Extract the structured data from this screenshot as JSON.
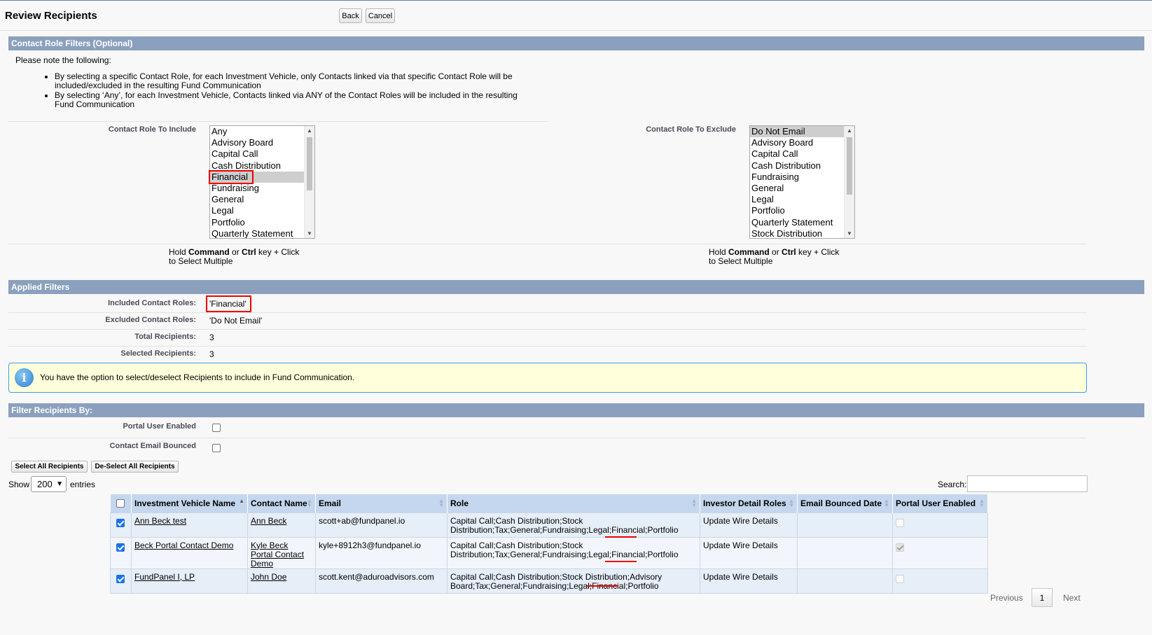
{
  "header": {
    "title": "Review Recipients",
    "back_label": "Back",
    "cancel_label": "Cancel"
  },
  "contact_role_filters": {
    "section_title": "Contact Role Filters (Optional)",
    "note_intro": "Please note the following:",
    "notes": [
      "By selecting a specific Contact Role, for each Investment Vehicle, only Contacts linked via that specific Contact Role will be included/excluded in the resulting Fund Communication",
      "By selecting ‘Any’, for each Investment Vehicle, Contacts linked via ANY of the Contact Roles will be included in the resulting Fund Communication"
    ],
    "include": {
      "label": "Contact Role To Include",
      "options": [
        "Any",
        "Advisory Board",
        "Capital Call",
        "Cash Distribution",
        "Financial",
        "Fundraising",
        "General",
        "Legal",
        "Portfolio",
        "Quarterly Statement"
      ],
      "selected": "Financial"
    },
    "exclude": {
      "label": "Contact Role To Exclude",
      "options": [
        "Do Not Email",
        "Advisory Board",
        "Capital Call",
        "Cash Distribution",
        "Fundraising",
        "General",
        "Legal",
        "Portfolio",
        "Quarterly Statement",
        "Stock Distribution"
      ],
      "selected": "Do Not Email"
    },
    "hint": {
      "hold": "Hold ",
      "command": "Command",
      "or": " or ",
      "ctrl": "Ctrl",
      "rest1": " key + Click",
      "rest2": "to Select Multiple"
    }
  },
  "applied_filters": {
    "section_title": "Applied Filters",
    "rows": [
      {
        "label": "Included Contact Roles:",
        "value": "'Financial'"
      },
      {
        "label": "Excluded Contact Roles:",
        "value": "'Do Not Email'"
      },
      {
        "label": "Total Recipients:",
        "value": "3"
      },
      {
        "label": "Selected Recipients:",
        "value": "3"
      }
    ]
  },
  "info_message": "You have the option to select/deselect Recipients to include in Fund Communication.",
  "filter_recipients": {
    "section_title": "Filter Recipients By:",
    "portal_user_enabled_label": "Portal User Enabled",
    "contact_email_bounced_label": "Contact Email Bounced",
    "portal_user_enabled_checked": false,
    "contact_email_bounced_checked": false
  },
  "actions": {
    "select_all": "Select All Recipients",
    "deselect_all": "De-Select All Recipients"
  },
  "table_controls": {
    "show_label": "Show",
    "entries_value": "200",
    "entries_label": "entries",
    "search_label": "Search:",
    "search_value": ""
  },
  "table": {
    "columns": [
      "Investment Vehicle Name",
      "Contact Name",
      "Email",
      "Role",
      "Investor Detail Roles",
      "Email Bounced Date",
      "Portal User Enabled"
    ],
    "rows": [
      {
        "selected": true,
        "vehicle": "Ann Beck test",
        "contact": "Ann Beck",
        "email": "scott+ab@fundpanel.io",
        "role": "Capital Call;Cash Distribution;Stock Distribution;Tax;General;Fundraising;Legal;Financial;Portfolio",
        "investor_roles": "Update Wire Details",
        "bounced_date": "",
        "portal_enabled": false
      },
      {
        "selected": true,
        "vehicle": "Beck Portal Contact Demo",
        "contact": "Kyle Beck Portal Contact Demo",
        "email": "kyle+8912h3@fundpanel.io",
        "role": "Capital Call;Cash Distribution;Stock Distribution;Tax;General;Fundraising;Legal;Financial;Portfolio",
        "investor_roles": "Update Wire Details",
        "bounced_date": "",
        "portal_enabled": true
      },
      {
        "selected": true,
        "vehicle": "FundPanel I, LP",
        "contact": "John Doe",
        "email": "scott.kent@aduroadvisors.com",
        "role": "Capital Call;Cash Distribution;Stock Distribution;Advisory Board;Tax;General;Fundraising;Legal;Financial;Portfolio",
        "investor_roles": "Update Wire Details",
        "bounced_date": "",
        "portal_enabled": false
      }
    ]
  },
  "pagination": {
    "previous": "Previous",
    "current_page": "1",
    "next": "Next"
  },
  "colors": {
    "section_bar": "#8aa0bd",
    "table_header": "#c4d7ee",
    "highlight": "#ee0000",
    "info_bg": "#ffffdc"
  }
}
